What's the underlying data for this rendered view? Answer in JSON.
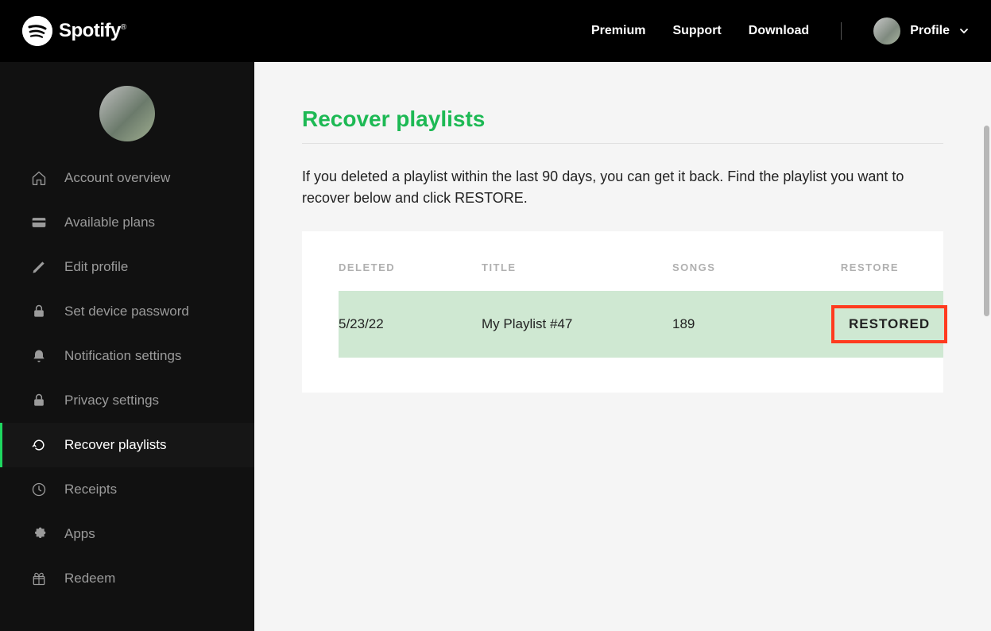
{
  "brand": {
    "name": "Spotify"
  },
  "nav": {
    "links": [
      "Premium",
      "Support",
      "Download"
    ],
    "profile_label": "Profile"
  },
  "sidebar": {
    "items": [
      {
        "icon": "home",
        "label": "Account overview"
      },
      {
        "icon": "card",
        "label": "Available plans"
      },
      {
        "icon": "pencil",
        "label": "Edit profile"
      },
      {
        "icon": "lock",
        "label": "Set device password"
      },
      {
        "icon": "bell",
        "label": "Notification settings"
      },
      {
        "icon": "lock",
        "label": "Privacy settings"
      },
      {
        "icon": "refresh",
        "label": "Recover playlists",
        "active": true
      },
      {
        "icon": "clock",
        "label": "Receipts"
      },
      {
        "icon": "puzzle",
        "label": "Apps"
      },
      {
        "icon": "gift",
        "label": "Redeem"
      }
    ]
  },
  "page": {
    "title": "Recover playlists",
    "description": "If you deleted a playlist within the last 90 days, you can get it back. Find the playlist you want to recover below and click RESTORE."
  },
  "table": {
    "headers": {
      "deleted": "DELETED",
      "title": "TITLE",
      "songs": "SONGS",
      "restore": "RESTORE"
    },
    "rows": [
      {
        "deleted": "5/23/22",
        "title": "My Playlist #47",
        "songs": "189",
        "restore_label": "RESTORED"
      }
    ]
  },
  "colors": {
    "accent": "#1db954",
    "highlight_row": "#cfe8d2",
    "callout_border": "#ff3b1f"
  }
}
